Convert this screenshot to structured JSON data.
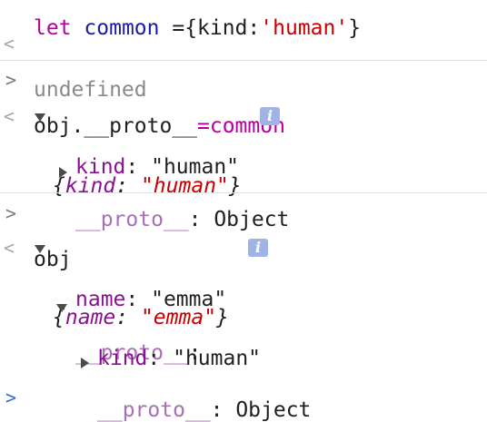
{
  "lines": {
    "l1": {
      "let": "let",
      "name": "common",
      "eq": " ={kind:",
      "str": "'human'",
      "close": "}"
    },
    "l2": {
      "text": "undefined"
    },
    "l3": {
      "a": "obj.",
      "b": "__proto__",
      "c": "=common"
    },
    "l4": {
      "open": "{",
      "key": "kind",
      "colon": ": ",
      "str": "\"human\"",
      "close": "}"
    },
    "l5": {
      "key": "kind",
      "colon": ": ",
      "str": "\"human\""
    },
    "l6": {
      "key": "__proto__",
      "rest": ": Object"
    },
    "l7": {
      "text": "obj"
    },
    "l8": {
      "open": "{",
      "key": "name",
      "colon": ": ",
      "str": "\"emma\"",
      "close": "}"
    },
    "l9": {
      "key": "name",
      "colon": ": ",
      "str": "\"emma\""
    },
    "l10": {
      "key": "__proto__",
      "rest": ":"
    },
    "l11": {
      "key": "kind",
      "colon": ": ",
      "str": "\"human\""
    },
    "l12": {
      "key": "__proto__",
      "rest": ": Object"
    }
  },
  "glyphs": {
    "prompt": ">",
    "return": "<",
    "info": "i"
  },
  "icons": {
    "prompt": "chevron-right-icon",
    "return": "chevron-left-icon",
    "expand": "triangle-right-icon",
    "collapse": "triangle-down-icon",
    "info": "info-icon"
  }
}
